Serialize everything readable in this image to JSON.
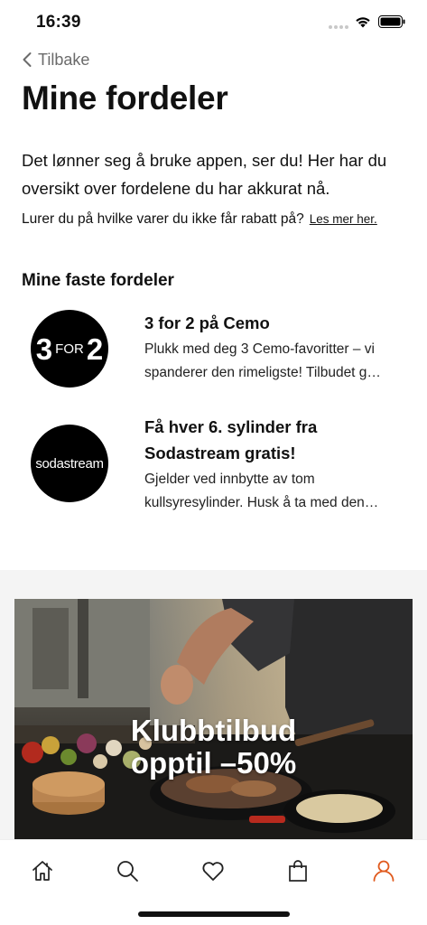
{
  "status_bar": {
    "time": "16:39"
  },
  "nav": {
    "back_label": "Tilbake"
  },
  "page": {
    "title": "Mine fordeler",
    "intro": "Det lønner seg å bruke appen, ser du! Her har du oversikt over fordelene du har akkurat nå.",
    "rabatt_question": "Lurer du på hvilke varer du ikke får rabatt på?",
    "les_mer_link": "Les mer her."
  },
  "fixed_benefits": {
    "section_title": "Mine faste fordeler",
    "items": [
      {
        "logo": {
          "big_left": "3",
          "small": "FOR",
          "big_right": "2"
        },
        "title_lines": [
          "3 for 2 på Cemo"
        ],
        "desc_lines": [
          "Plukk med deg 3 Cemo-favoritter – vi",
          "spanderer den rimeligste! Tilbudet g…"
        ]
      },
      {
        "logo": {
          "text": "sodastream"
        },
        "title_lines": [
          "Få hver 6. sylinder fra",
          "Sodastream gratis!"
        ],
        "desc_lines": [
          "Gjelder ved innbytte av tom",
          "kullsyresylinder. Husk å ta med den…"
        ]
      }
    ]
  },
  "promo": {
    "line1": "Klubbtilbud",
    "line2": "opptil –50%"
  },
  "tab_bar": {
    "items": [
      "home-icon",
      "search-icon",
      "heart-icon",
      "shopping-bag-icon",
      "profile-icon"
    ],
    "active": "profile-icon",
    "active_color": "#e05a1e",
    "inactive_color": "#222222"
  }
}
